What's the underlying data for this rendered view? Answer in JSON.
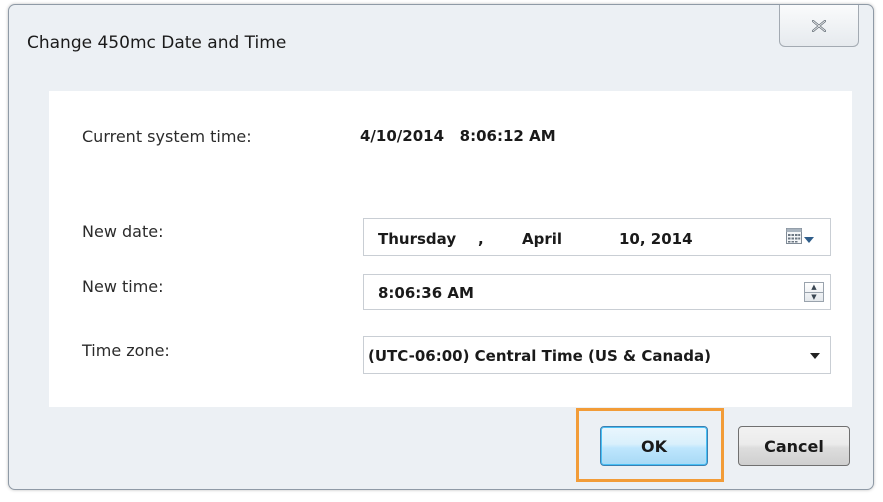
{
  "window": {
    "title": "Change 450mc Date and Time",
    "close_icon": "close-icon"
  },
  "form": {
    "current_time_label": "Current system time:",
    "current_time_value": "4/10/2014   8:06:12 AM",
    "new_date_label": "New date:",
    "new_date": {
      "weekday": "Thursday",
      "separator": ",",
      "month": "April",
      "day_year": "10, 2014"
    },
    "new_time_label": "New time:",
    "new_time_value": "8:06:36 AM",
    "time_zone_label": "Time zone:",
    "time_zone_value": "(UTC-06:00) Central Time (US & Canada)"
  },
  "buttons": {
    "ok_label": "OK",
    "cancel_label": "Cancel"
  },
  "colors": {
    "highlight": "#f29c38",
    "ok_button_border": "#3c7fb1"
  }
}
